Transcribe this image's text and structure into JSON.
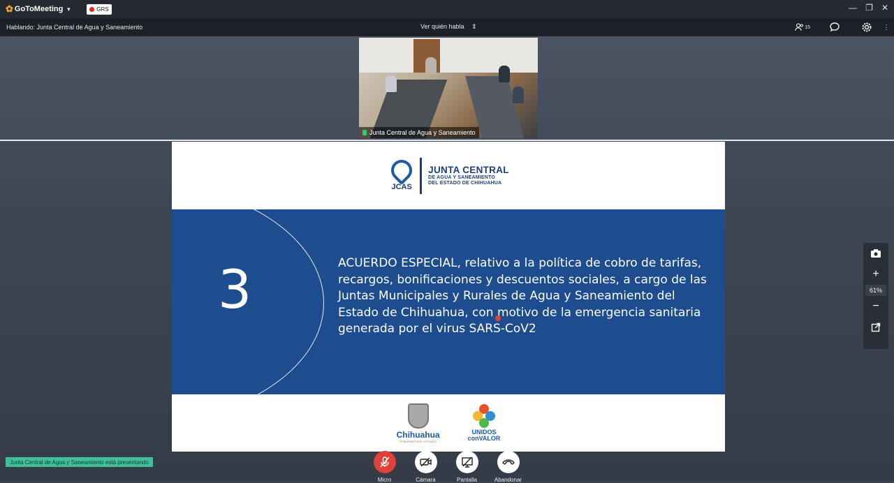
{
  "app": {
    "name": "GoToMeeting",
    "recording_badge": "GRS"
  },
  "window_controls": {
    "minimize": "—",
    "restore": "❐",
    "close": "✕"
  },
  "toolbar": {
    "speaking": "Hablando: Junta Central de Agua y Saneamiento",
    "view_selector": "Ver quién habla",
    "participants_count": "15"
  },
  "video": {
    "label": "Junta Central de Agua y Saneamiento"
  },
  "slide": {
    "org_abbr": "JCAS",
    "org_title": "JUNTA CENTRAL",
    "org_sub1": "DE AGUA Y SANEAMIENTO",
    "org_sub2": "DEL ESTADO DE CHIHUAHUA",
    "number": "3",
    "text": "ACUERDO ESPECIAL, relativo a la política de cobro de tarifas, recargos, bonificaciones y descuentos sociales, a cargo de las Juntas Municipales y Rurales de Agua y Saneamiento del Estado de Chihuahua, con motivo de la emergencia sanitaria generada por el virus SARS-CoV2",
    "footer_logo1": "Chihuahua",
    "footer_logo1_sub": "GOBIERNO DEL ESTADO",
    "footer_logo2_line1": "UNIDOS",
    "footer_logo2_line2": "conVALOR"
  },
  "side_controls": {
    "zoom": "61%"
  },
  "status": {
    "presenting": "Junta Central de Agua y Saneamiento está presentando"
  },
  "bottom_bar": {
    "mic": "Micro",
    "camera": "Cámara",
    "screen": "Pantalla",
    "leave": "Abandonar"
  },
  "colors": {
    "band_blue": "#1d4c8f",
    "mic_red": "#e0413a",
    "presenting_green": "#3fbf9a"
  }
}
